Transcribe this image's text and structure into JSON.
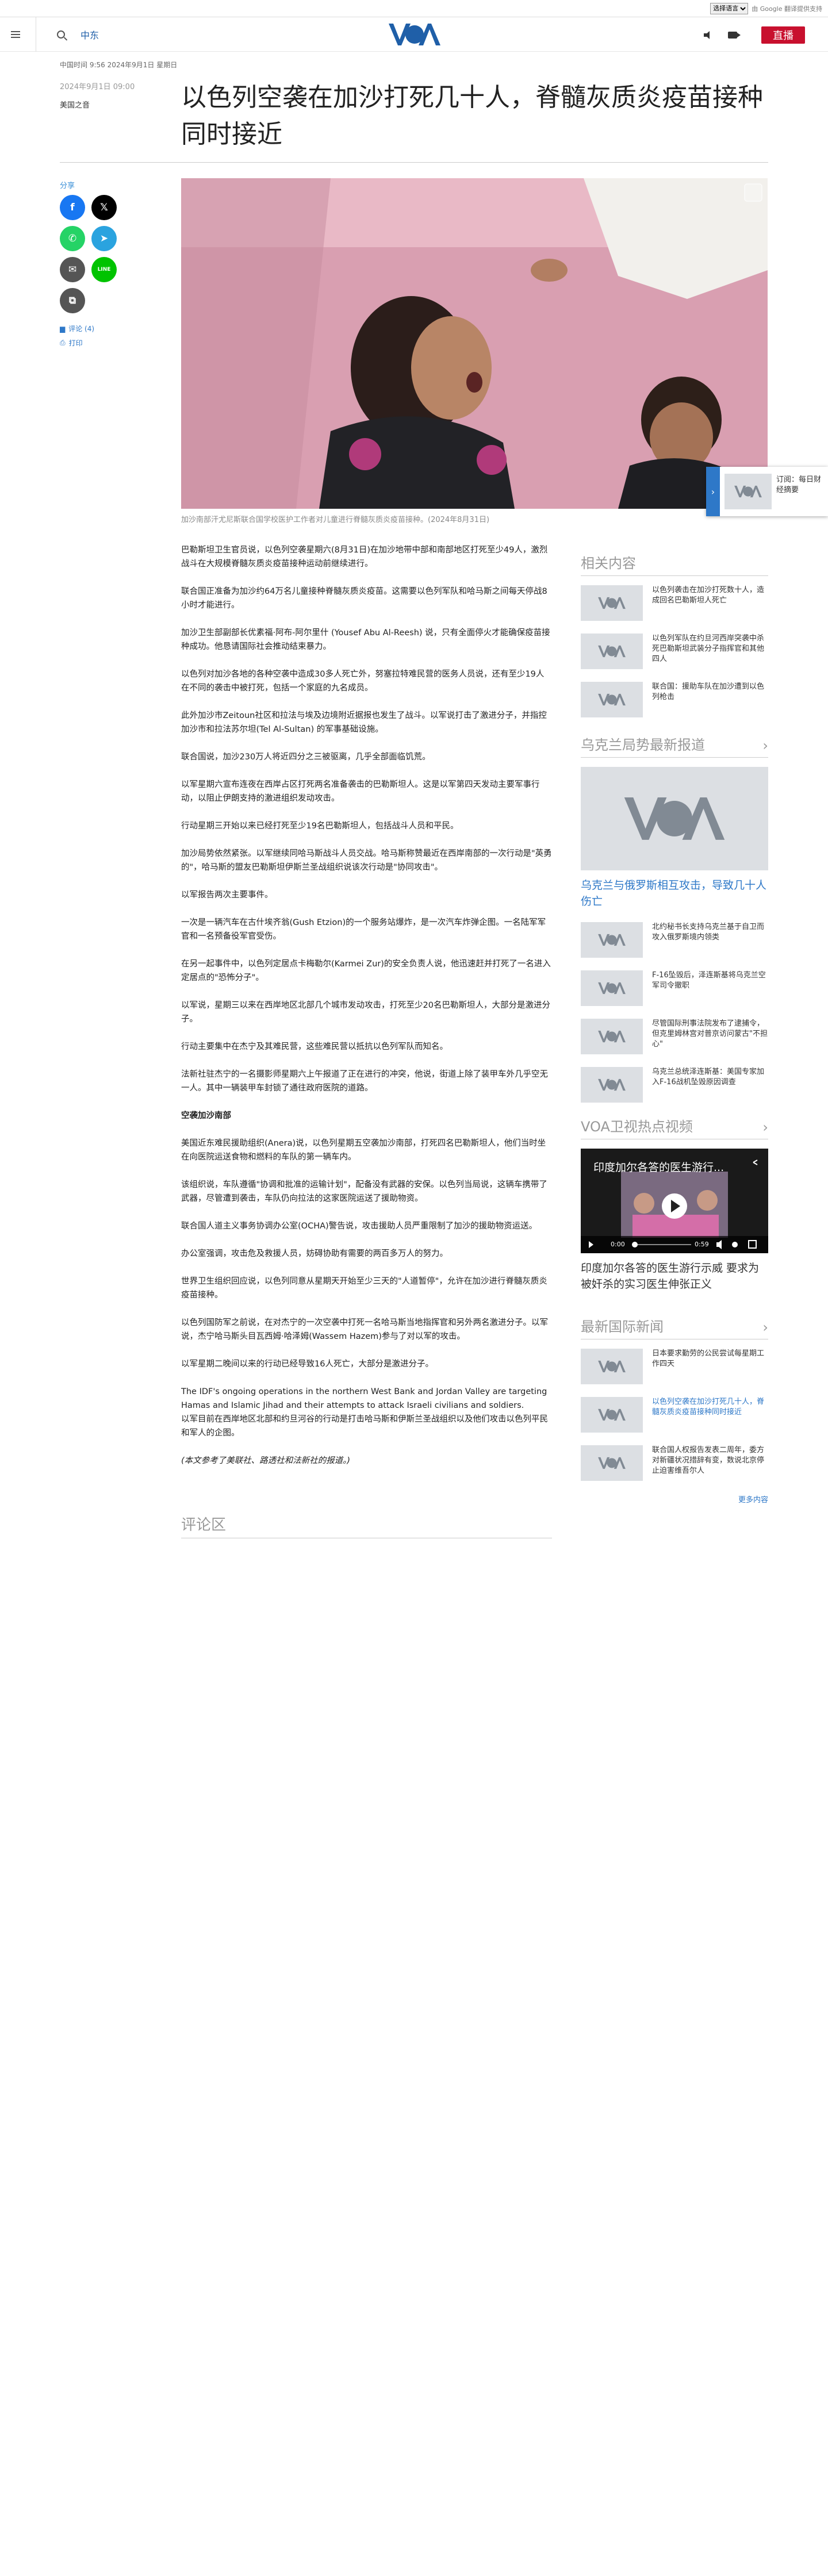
{
  "topbar": {
    "translate_select": "选择语言",
    "powered_by": "由 Google 翻译提供支持"
  },
  "header": {
    "section_link": "中东",
    "live_label": "直播",
    "logo_text": "VOA"
  },
  "dateline": "中国时间 9:56 2024年9月1日 星期日",
  "headline": "以色列空袭在加沙打死几十人，脊髓灰质炎疫苗接种同时接近",
  "meta": {
    "date": "2024年9月1日 09:00",
    "author": "美国之音"
  },
  "share": {
    "title": "分享",
    "buttons": [
      {
        "name": "facebook",
        "glyph": "f",
        "color": "#1877f2"
      },
      {
        "name": "x",
        "glyph": "𝕏",
        "color": "#000000"
      },
      {
        "name": "whatsapp",
        "glyph": "✆",
        "color": "#25d366"
      },
      {
        "name": "telegram",
        "glyph": "➤",
        "color": "#2aa3df"
      },
      {
        "name": "email",
        "glyph": "✉",
        "color": "#555555"
      },
      {
        "name": "line",
        "glyph": "LINE",
        "color": "#00c300"
      },
      {
        "name": "copy",
        "glyph": "⧉",
        "color": "#555555"
      }
    ],
    "comments_link": "评论 (4)",
    "print_link": "打印"
  },
  "hero": {
    "caption": "加沙南部汗尤尼斯联合国学校医护工作者对儿童进行脊髓灰质炎疫苗接种。(2024年8月31日)"
  },
  "article": {
    "paragraphs": [
      "巴勒斯坦卫生官员说，以色列空袭星期六(8月31日)在加沙地带中部和南部地区打死至少49人，激烈战斗在大规模脊髓灰质炎疫苗接种运动前继续进行。",
      "联合国正准备为加沙约64万名儿童接种脊髓灰质炎疫苗。这需要以色列军队和哈马斯之间每天停战8小时才能进行。",
      "加沙卫生部副部长优素福·阿布-阿尔里什 (Yousef Abu Al-Reesh) 说，只有全面停火才能确保疫苗接种成功。他恳请国际社会推动结束暴力。",
      "以色列对加沙各地的各种空袭中造成30多人死亡外，努塞拉特难民营的医务人员说，还有至少19人在不同的袭击中被打死，包括一个家庭的九名成员。",
      "此外加沙市Zeitoun社区和拉法与埃及边境附近据报也发生了战斗。以军说打击了激进分子，并指控加沙市和拉法苏尔坦(Tel Al-Sultan) 的军事基础设施。",
      "联合国说，加沙230万人将近四分之三被驱离，几乎全部面临饥荒。",
      "以军星期六宣布连夜在西岸占区打死两名准备袭击的巴勒斯坦人。这是以军第四天发动主要军事行动，以阻止伊朗支持的激进组织发动攻击。",
      "行动星期三开始以来已经打死至少19名巴勒斯坦人，包括战斗人员和平民。",
      "加沙局势依然紧张。以军继续同哈马斯战斗人员交战。哈马斯称赞最近在西岸南部的一次行动是\"英勇的\"，哈马斯的盟友巴勒斯坦伊斯兰圣战组织说该次行动是\"协同攻击\"。",
      "以军报告两次主要事件。",
      "一次是一辆汽车在古什埃齐翁(Gush Etzion)的一个服务站爆炸，是一次汽车炸弹企图。一名陆军军官和一名预备役军官受伤。",
      "在另一起事件中，以色列定居点卡梅勒尔(Karmei Zur)的安全负责人说，他迅速赶并打死了一名进入定居点的\"恐怖分子\"。",
      "以军说，星期三以来在西岸地区北部几个城市发动攻击，打死至少20名巴勒斯坦人，大部分是激进分子。",
      "行动主要集中在杰宁及其难民营，这些难民营以抵抗以色列军队而知名。",
      "法新社驻杰宁的一名摄影师星期六上午报道了正在进行的冲突，他说，街道上除了装甲车外几乎空无一人。其中一辆装甲车封锁了通往政府医院的道路。"
    ],
    "subhead": "空袭加沙南部",
    "paragraphs2": [
      "美国近东难民援助组织(Anera)说，以色列星期五空袭加沙南部，打死四名巴勒斯坦人，他们当时坐在向医院运送食物和燃料的车队的第一辆车内。",
      "该组织说，车队遵循\"协调和批准的运输计划\"，配备没有武器的安保。以色列当局说，这辆车携带了武器，尽管遭到袭击，车队仍向拉法的这家医院运送了援助物资。",
      "联合国人道主义事务协调办公室(OCHA)警告说，攻击援助人员严重限制了加沙的援助物资运送。",
      "办公室强调，攻击危及救援人员，妨碍协助有需要的两百多万人的努力。",
      "世界卫生组织回应说，以色列同意从星期天开始至少三天的\"人道暂停\"，允许在加沙进行脊髓灰质炎疫苗接种。",
      "以色列国防军之前说，在对杰宁的一次空袭中打死一名哈马斯当地指挥官和另外两名激进分子。以军说，杰宁哈马斯头目瓦西姆·哈泽姆(Wassem Hazem)参与了对以军的攻击。",
      "以军星期二晚间以来的行动已经导致16人死亡，大部分是激进分子。",
      "The IDF's ongoing operations in the northern West Bank and Jordan Valley are targeting Hamas and Islamic Jihad and their attempts to attack Israeli civilians and soldiers.\n以军目前在西岸地区北部和约旦河谷的行动是打击哈马斯和伊斯兰圣战组织以及他们攻击以色列平民和军人的企图。"
    ],
    "note": "(本文参考了美联社、路透社和法新社的报道。)"
  },
  "comments_heading": "评论区",
  "sidebar": {
    "related": {
      "title": "相关内容",
      "items": [
        {
          "title": "以色列袭击在加沙打死数十人，造成回名巴勒斯坦人死亡"
        },
        {
          "title": "以色列军队在约旦河西岸突袭中杀死巴勒斯坦武装分子指挥官和其他四人"
        },
        {
          "title": "联合国：援助车队在加沙遭到以色列枪击"
        }
      ]
    },
    "ukraine": {
      "title": "乌克兰局势最新报道",
      "lead_title": "乌克兰与俄罗斯相互攻击，导致几十人伤亡",
      "items": [
        {
          "title": "北约秘书长支持乌克兰基于自卫而攻入俄罗斯境内领类"
        },
        {
          "title": "F-16坠毁后，泽连斯基将乌克兰空军司令撤职"
        },
        {
          "title": "尽管国际刑事法院发布了逮捕令，但克里姆林宫对普京访问蒙古\"不担心\""
        },
        {
          "title": "乌克兰总统泽连斯基：美国专家加入F-16战机坠毁原因调查"
        }
      ]
    },
    "video": {
      "title": "VOA卫视热点视频",
      "player_title": "印度加尔各答的医生游行...",
      "time_current": "0:00",
      "time_total": "0:59",
      "caption": "印度加尔各答的医生游行示威 要求为被奸杀的实习医生伸张正义"
    },
    "intl": {
      "title": "最新国际新闻",
      "items": [
        {
          "title": "日本要求勤劳的公民尝试每星期工作四天",
          "highlight": false
        },
        {
          "title": "以色列空袭在加沙打死几十人，脊髓灰质炎疫苗接种同时接近",
          "highlight": true
        },
        {
          "title": "联合国人权报告发表二周年，委方对新疆状况措辞有变，数说北京停止迫害维吾尔人"
        }
      ],
      "more": "更多内容"
    }
  },
  "float_widget": {
    "title": "订阅：每日财经摘要"
  }
}
